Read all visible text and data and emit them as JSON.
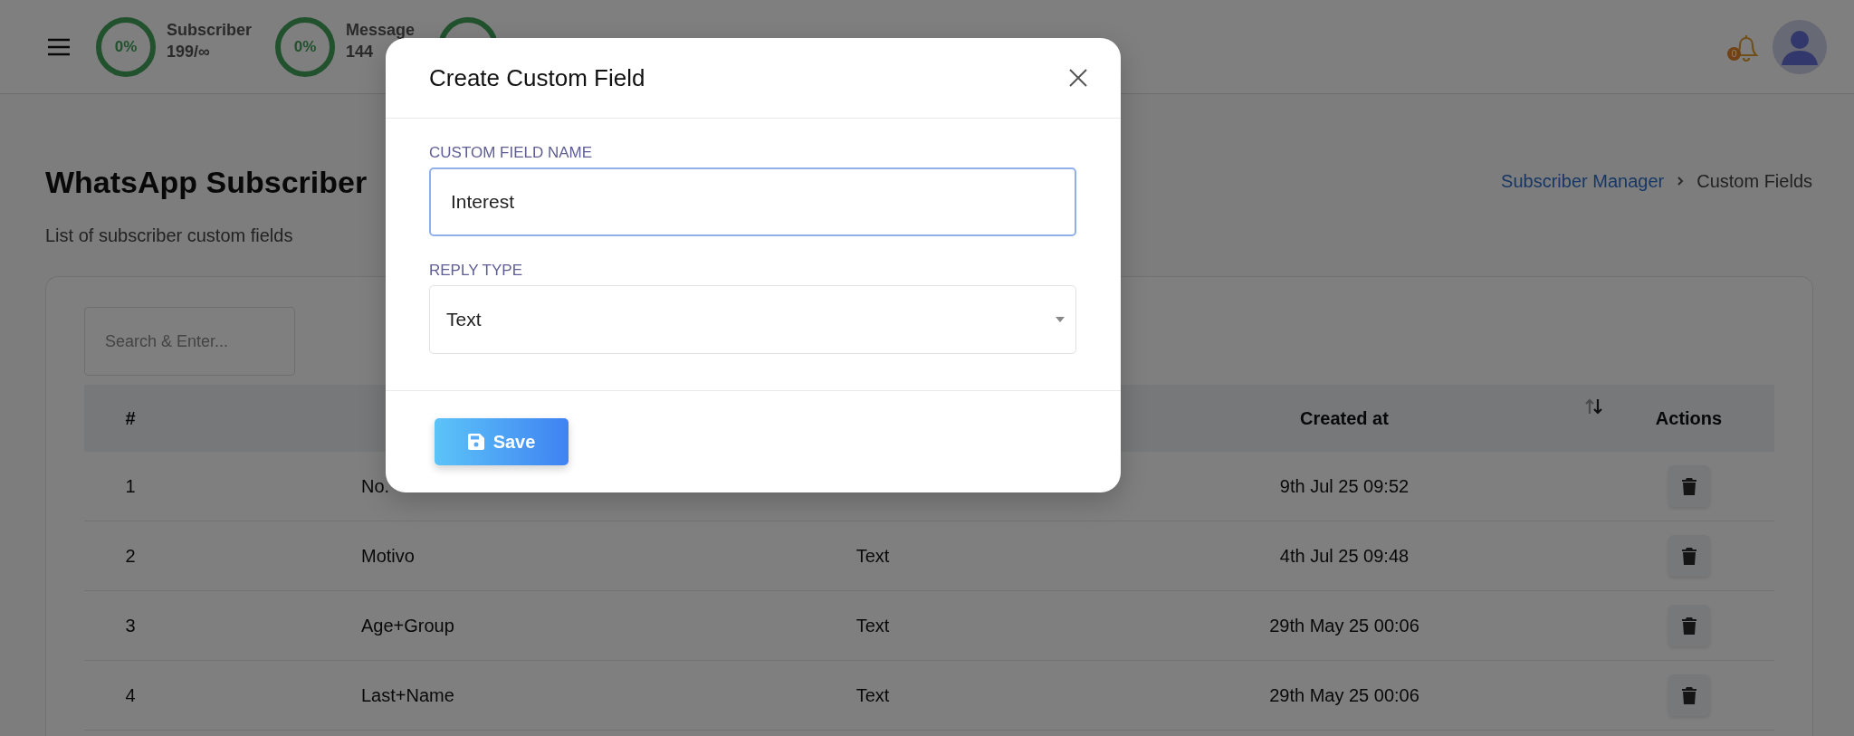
{
  "header": {
    "stats": [
      {
        "kind": "stat",
        "percent": "0%",
        "label": "Subscriber",
        "value": "199/∞"
      },
      {
        "kind": "stat",
        "percent": "0%",
        "label": "Message",
        "value": "144"
      },
      {
        "kind": "ring"
      }
    ],
    "notification_badge": "0"
  },
  "page": {
    "title": "WhatsApp Subscriber",
    "subtitle": "List of subscriber custom fields",
    "breadcrumb": [
      {
        "label": "Subscriber Manager",
        "link": true
      },
      {
        "label": "Custom Fields",
        "link": false
      }
    ]
  },
  "table": {
    "search": {
      "placeholder": "Search & Enter..."
    },
    "headers": {
      "number": "#",
      "created_at": "Created at",
      "actions": "Actions"
    },
    "sort_descending": true,
    "rows": [
      {
        "number": "1",
        "name": "No.",
        "created_at": "9th Jul 25 09:52"
      },
      {
        "number": "2",
        "name": "Motivo",
        "type": "Text",
        "created_at": "4th Jul 25 09:48"
      },
      {
        "number": "3",
        "name": "Age+Group",
        "type": "Text",
        "created_at": "29th May 25 00:06"
      },
      {
        "number": "4",
        "name": "Last+Name",
        "type": "Text",
        "created_at": "29th May 25 00:06"
      }
    ]
  },
  "modal": {
    "title": "Create Custom Field",
    "fields": [
      {
        "kind": "text",
        "label": "CUSTOM FIELD NAME",
        "value": "Interest",
        "focused": true
      },
      {
        "kind": "select",
        "label": "REPLY TYPE",
        "value": "Text",
        "focused": false
      }
    ],
    "save_button": "Save"
  }
}
